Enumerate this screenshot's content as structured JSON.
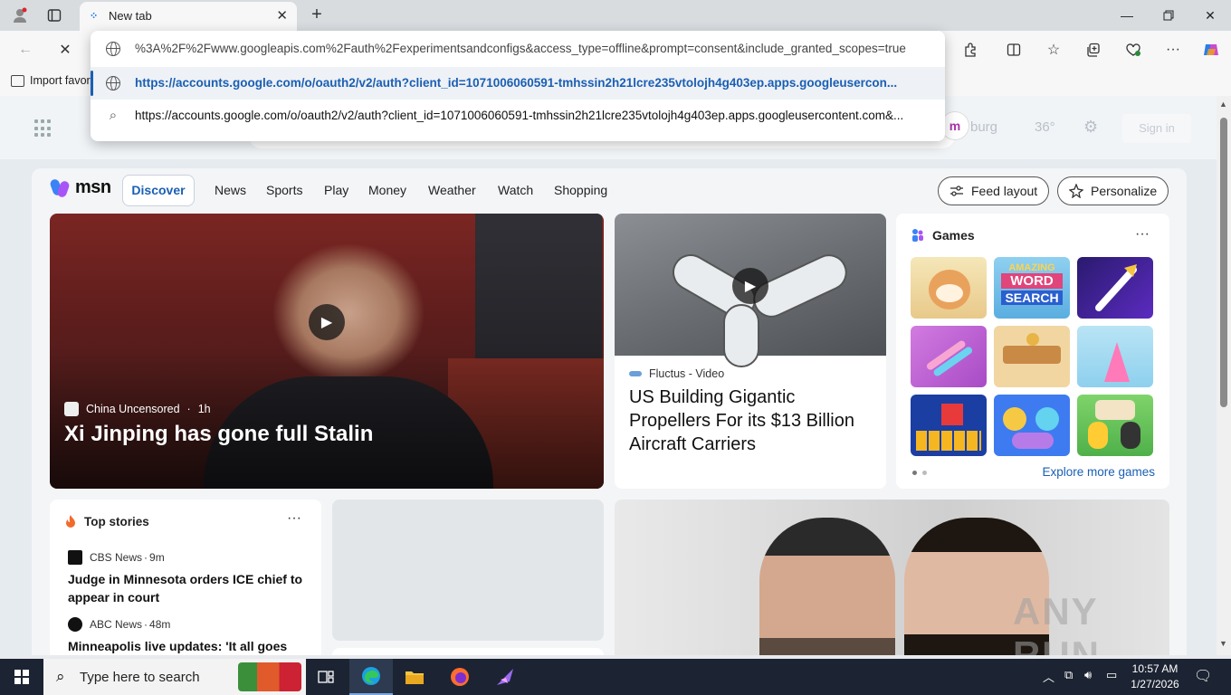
{
  "browser": {
    "tab": {
      "title": "New tab"
    },
    "favorites_bar": {
      "import_label": "Import favor"
    }
  },
  "omnibox": {
    "rows": [
      {
        "text": "%3A%2F%2Fwww.googleapis.com%2Fauth%2Fexperimentsandconfigs&access_type=offline&prompt=consent&include_granted_scopes=true",
        "icon": "globe-icon"
      },
      {
        "text": "https://accounts.google.com/o/oauth2/v2/auth?client_id=1071006060591-tmhssin2h21lcre235vtolojh4g403ep.apps.googleusercon...",
        "icon": "globe-icon",
        "selected": true
      },
      {
        "text": "https://accounts.google.com/o/oauth2/v2/auth?client_id=1071006060591-tmhssin2h21lcre235vtolojh4g403ep.apps.googleusercontent.com&...",
        "icon": "search-icon"
      }
    ]
  },
  "msn": {
    "header": {
      "location": "burg",
      "temperature": "36°",
      "sign_in": "Sign in"
    },
    "logo": "msn",
    "nav": {
      "discover": "Discover",
      "items": [
        "News",
        "Sports",
        "Play",
        "Money",
        "Weather",
        "Watch",
        "Shopping"
      ],
      "feed_layout": "Feed layout",
      "personalize": "Personalize"
    },
    "hero": {
      "source": "China Uncensored",
      "age": "1h",
      "title": "Xi Jinping has gone full Stalin"
    },
    "article": {
      "source": "Fluctus - Video",
      "title": "US Building Gigantic Propellers For its $13 Billion Aircraft Carriers"
    },
    "games": {
      "title": "Games",
      "explore": "Explore more games",
      "tile_labels": {
        "word_search_1": "AMAZING",
        "word_search_2": "WORD",
        "word_search_3": "SEARCH"
      }
    },
    "top_stories": {
      "title": "Top stories",
      "items": [
        {
          "source": "CBS News",
          "age": "9m",
          "title": "Judge in Minnesota orders ICE chief to appear in court"
        },
        {
          "source": "ABC News",
          "age": "48m",
          "title": "Minneapolis live updates: 'It all goes"
        }
      ]
    },
    "watermark": "ANY RUN"
  },
  "taskbar": {
    "search_placeholder": "Type here to search",
    "time": "10:57 AM",
    "date": "1/27/2026"
  },
  "colors": {
    "accent": "#1a5fb4",
    "taskbar": "#1c2433"
  }
}
